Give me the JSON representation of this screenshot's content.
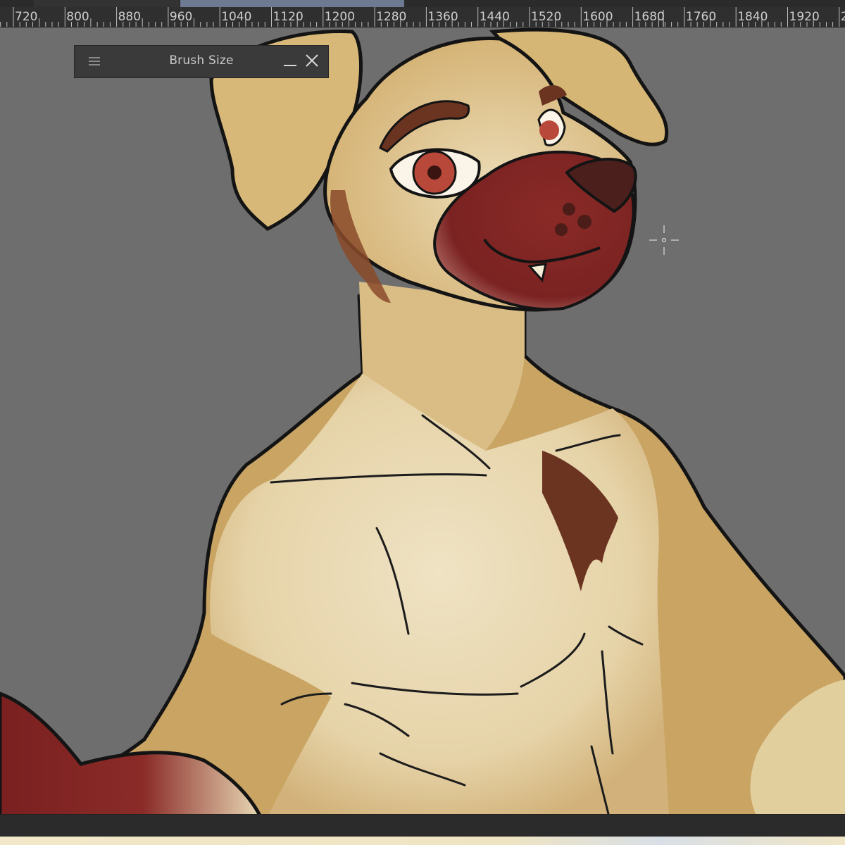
{
  "ruler": {
    "labels": [
      "720",
      "800",
      "880",
      "960",
      "1040",
      "1120",
      "1200",
      "1280",
      "1360",
      "1440",
      "1520",
      "1600",
      "1680",
      "1760",
      "1840",
      "1920",
      "2"
    ]
  },
  "brush_panel": {
    "title": "Brush Size",
    "menu_icon": "hamburger-icon",
    "minimize_icon": "minimize-icon",
    "close_icon": "close-icon"
  },
  "cursor": {
    "icon": "crosshair-icon"
  },
  "colors": {
    "workspace_bg": "#6e6e6e",
    "fur_base": "#c9a463",
    "fur_light": "#eadcb8",
    "muzzle": "#7a2322",
    "accent_brown": "#6b3421",
    "outline": "#141414",
    "active_tab": "#6e7a92"
  }
}
